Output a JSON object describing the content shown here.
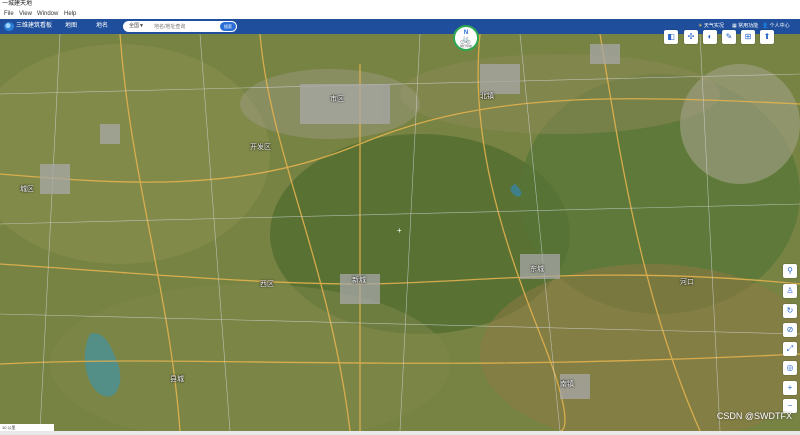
{
  "window": {
    "title": "一城建天地"
  },
  "menu": {
    "items": [
      "File",
      "View",
      "Window",
      "Help"
    ]
  },
  "toolbar": {
    "app_name": "三维建筑看板",
    "tabs": [
      "地图",
      "地名"
    ],
    "search": {
      "scope": "全国▼",
      "placeholder": "地名/地址查询",
      "button": "搜索"
    },
    "right": {
      "weather": "天气实况",
      "tools": "常用功能",
      "user": "个人中心"
    }
  },
  "compass": {
    "north": "N",
    "label": "骑行导航"
  },
  "tools": [
    {
      "icon": "layers-icon",
      "label": ""
    },
    {
      "icon": "measure-icon",
      "label": ""
    },
    {
      "icon": "mark-icon",
      "label": ""
    },
    {
      "icon": "draw-icon",
      "label": ""
    },
    {
      "icon": "split-icon",
      "label": ""
    },
    {
      "icon": "more-icon",
      "label": ""
    }
  ],
  "side_controls": [
    "street-view-icon",
    "pegman-icon",
    "rotate-icon",
    "tilt-icon",
    "fullscreen-icon",
    "locate-icon",
    "zoom-in-icon",
    "zoom-out-icon"
  ],
  "places": [
    {
      "name": "市区"
    },
    {
      "name": "城区"
    },
    {
      "name": "新城"
    },
    {
      "name": "西区"
    },
    {
      "name": "东城"
    },
    {
      "name": "北镇"
    },
    {
      "name": "南镇"
    },
    {
      "name": "县城"
    },
    {
      "name": "河口"
    },
    {
      "name": "开发区"
    }
  ],
  "scale": {
    "text": "10 公里"
  },
  "watermark": "CSDN @SWDTFX"
}
